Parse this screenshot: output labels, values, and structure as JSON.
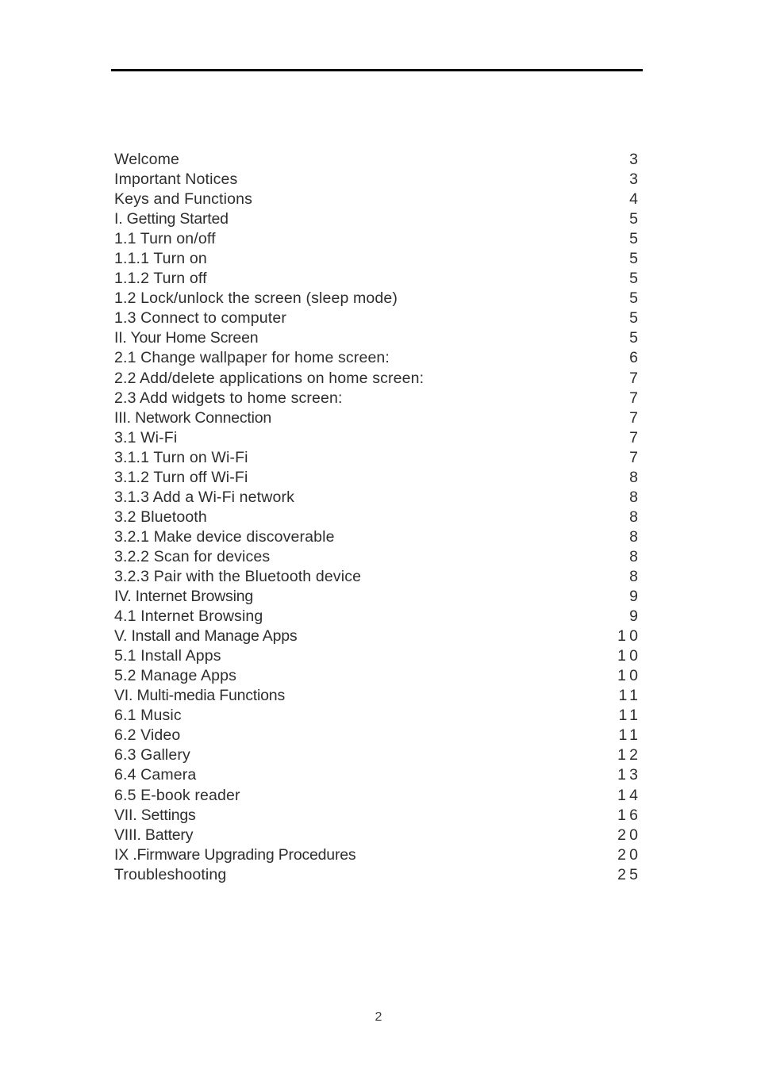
{
  "document": {
    "footer_page_number": "2",
    "rule_color": "#000000",
    "text_color": "#2e2e2e"
  },
  "toc": {
    "entries": [
      {
        "title": "Welcome",
        "page": "3"
      },
      {
        "title": "Important Notices",
        "page": "3"
      },
      {
        "title": "Keys and Functions",
        "page": "4"
      },
      {
        "title": "I. Getting Started",
        "page": "5"
      },
      {
        "title": "1.1 Turn on/off",
        "page": "5"
      },
      {
        "title": "1.1.1 Turn on",
        "page": "5"
      },
      {
        "title": "1.1.2 Turn off",
        "page": "5"
      },
      {
        "title": "1.2 Lock/unlock the screen (sleep mode)",
        "page": "5"
      },
      {
        "title": "1.3 Connect to computer",
        "page": "5"
      },
      {
        "title": "II. Your Home Screen",
        "page": "5"
      },
      {
        "title": "2.1 Change wallpaper for home screen:",
        "page": "6"
      },
      {
        "title": "2.2 Add/delete applications on home screen:",
        "page": "7"
      },
      {
        "title": "2.3 Add widgets to home screen:",
        "page": "7"
      },
      {
        "title": "III. Network Connection",
        "page": "7"
      },
      {
        "title": "3.1 Wi-Fi",
        "page": "7"
      },
      {
        "title": "3.1.1 Turn on Wi-Fi",
        "page": "7"
      },
      {
        "title": "3.1.2 Turn off Wi-Fi",
        "page": "8"
      },
      {
        "title": "3.1.3 Add a Wi-Fi network",
        "page": "8"
      },
      {
        "title": "3.2 Bluetooth",
        "page": "8"
      },
      {
        "title": "3.2.1 Make device discoverable",
        "page": "8"
      },
      {
        "title": "3.2.2 Scan for devices",
        "page": "8"
      },
      {
        "title": "3.2.3 Pair with the Bluetooth device",
        "page": "8"
      },
      {
        "title": "IV. Internet Browsing",
        "page": "9"
      },
      {
        "title": "4.1 Internet Browsing",
        "page": "9"
      },
      {
        "title": "V. Install and Manage Apps",
        "page": "10"
      },
      {
        "title": "5.1 Install Apps",
        "page": "10"
      },
      {
        "title": "5.2 Manage Apps",
        "page": "10"
      },
      {
        "title": "VI. Multi-media Functions",
        "page": "11"
      },
      {
        "title": "6.1  Music",
        "page": "11"
      },
      {
        "title": "6.2 Video",
        "page": "11"
      },
      {
        "title": "6.3 Gallery",
        "page": "12"
      },
      {
        "title": "6.4 Camera",
        "page": "13"
      },
      {
        "title": "6.5 E-book reader",
        "page": "14"
      },
      {
        "title": "VII. Settings",
        "page": "16"
      },
      {
        "title": "VIII. Battery",
        "page": "20"
      },
      {
        "title": "IX .Firmware Upgrading Procedures",
        "page": "20"
      },
      {
        "title": "Troubleshooting",
        "page": "25"
      }
    ]
  }
}
